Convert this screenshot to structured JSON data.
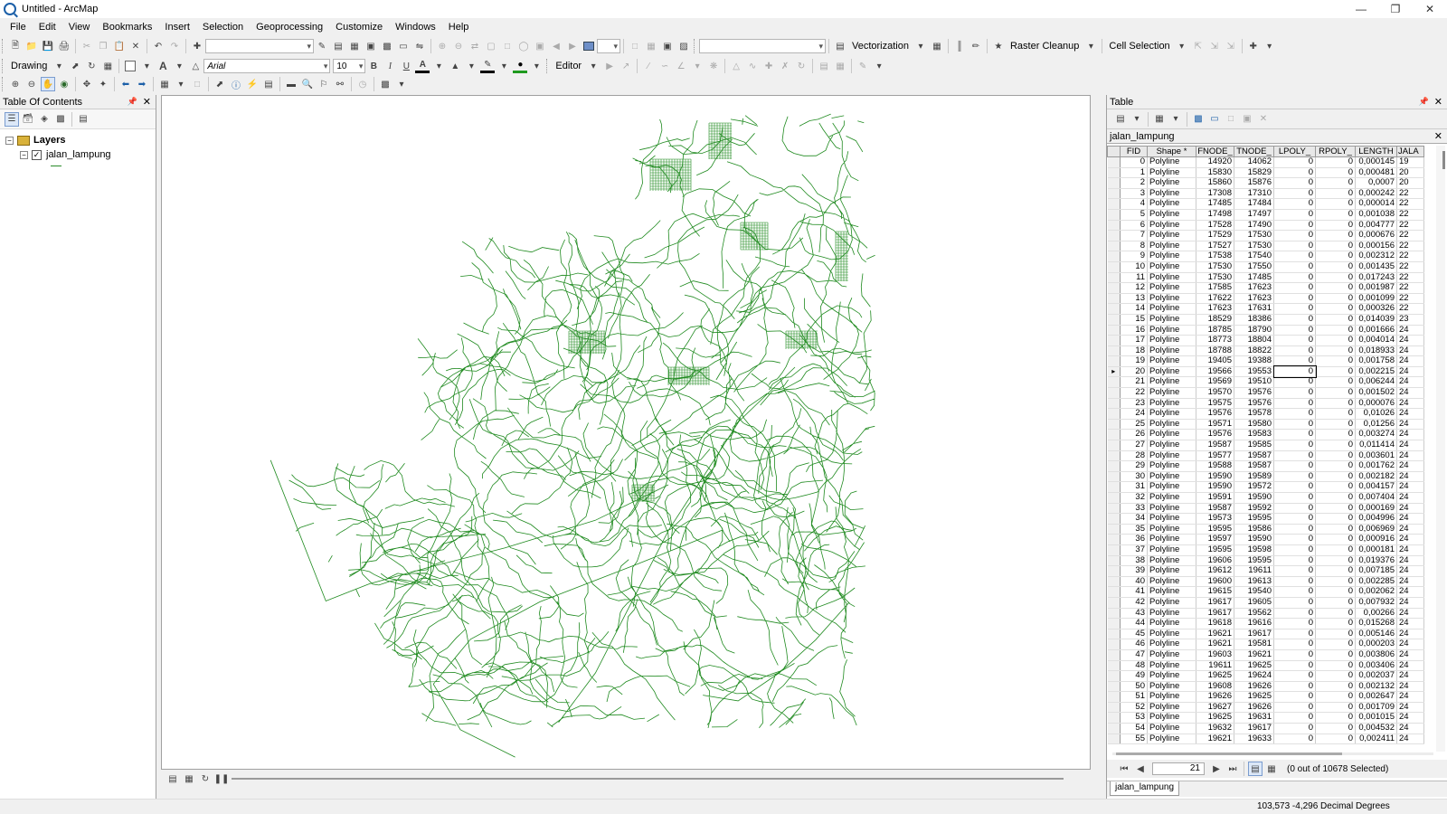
{
  "window": {
    "title": "Untitled - ArcMap",
    "controls": [
      "—",
      "❐",
      "✕"
    ]
  },
  "menu": [
    "File",
    "Edit",
    "View",
    "Bookmarks",
    "Insert",
    "Selection",
    "Geoprocessing",
    "Customize",
    "Windows",
    "Help"
  ],
  "toolbar2": {
    "vectorization_label": "Vectorization",
    "raster_cleanup_label": "Raster Cleanup",
    "cell_selection_label": "Cell Selection"
  },
  "toolbar3": {
    "drawing_label": "Drawing",
    "font_name": "Arial",
    "font_size": "10",
    "editor_label": "Editor",
    "bold": "B",
    "italic": "I",
    "underline": "U"
  },
  "toc": {
    "title": "Table Of Contents",
    "root_label": "Layers",
    "layer_name": "jalan_lampung",
    "layer_checked": true
  },
  "table": {
    "window_title": "Table",
    "table_name": "jalan_lampung",
    "columns": [
      "FID",
      "Shape *",
      "FNODE_",
      "TNODE_",
      "LPOLY_",
      "RPOLY_",
      "LENGTH",
      "JALA"
    ],
    "rows": [
      [
        "0",
        "Polyline",
        "14920",
        "14062",
        "0",
        "0",
        "0,000145",
        "19"
      ],
      [
        "1",
        "Polyline",
        "15830",
        "15829",
        "0",
        "0",
        "0,000481",
        "20"
      ],
      [
        "2",
        "Polyline",
        "15860",
        "15876",
        "0",
        "0",
        "0,0007",
        "20"
      ],
      [
        "3",
        "Polyline",
        "17308",
        "17310",
        "0",
        "0",
        "0,000242",
        "22"
      ],
      [
        "4",
        "Polyline",
        "17485",
        "17484",
        "0",
        "0",
        "0,000014",
        "22"
      ],
      [
        "5",
        "Polyline",
        "17498",
        "17497",
        "0",
        "0",
        "0,001038",
        "22"
      ],
      [
        "6",
        "Polyline",
        "17528",
        "17490",
        "0",
        "0",
        "0,004777",
        "22"
      ],
      [
        "7",
        "Polyline",
        "17529",
        "17530",
        "0",
        "0",
        "0,000676",
        "22"
      ],
      [
        "8",
        "Polyline",
        "17527",
        "17530",
        "0",
        "0",
        "0,000156",
        "22"
      ],
      [
        "9",
        "Polyline",
        "17538",
        "17540",
        "0",
        "0",
        "0,002312",
        "22"
      ],
      [
        "10",
        "Polyline",
        "17530",
        "17550",
        "0",
        "0",
        "0,001435",
        "22"
      ],
      [
        "11",
        "Polyline",
        "17530",
        "17485",
        "0",
        "0",
        "0,017243",
        "22"
      ],
      [
        "12",
        "Polyline",
        "17585",
        "17623",
        "0",
        "0",
        "0,001987",
        "22"
      ],
      [
        "13",
        "Polyline",
        "17622",
        "17623",
        "0",
        "0",
        "0,001099",
        "22"
      ],
      [
        "14",
        "Polyline",
        "17623",
        "17631",
        "0",
        "0",
        "0,000326",
        "22"
      ],
      [
        "15",
        "Polyline",
        "18529",
        "18386",
        "0",
        "0",
        "0,014039",
        "23"
      ],
      [
        "16",
        "Polyline",
        "18785",
        "18790",
        "0",
        "0",
        "0,001666",
        "24"
      ],
      [
        "17",
        "Polyline",
        "18773",
        "18804",
        "0",
        "0",
        "0,004014",
        "24"
      ],
      [
        "18",
        "Polyline",
        "18788",
        "18822",
        "0",
        "0",
        "0,018933",
        "24"
      ],
      [
        "19",
        "Polyline",
        "19405",
        "19388",
        "0",
        "0",
        "0,001758",
        "24"
      ],
      [
        "20",
        "Polyline",
        "19566",
        "19553",
        "0",
        "0",
        "0,002215",
        "24"
      ],
      [
        "21",
        "Polyline",
        "19569",
        "19510",
        "0",
        "0",
        "0,006244",
        "24"
      ],
      [
        "22",
        "Polyline",
        "19570",
        "19576",
        "0",
        "0",
        "0,001502",
        "24"
      ],
      [
        "23",
        "Polyline",
        "19575",
        "19576",
        "0",
        "0",
        "0,000076",
        "24"
      ],
      [
        "24",
        "Polyline",
        "19576",
        "19578",
        "0",
        "0",
        "0,01026",
        "24"
      ],
      [
        "25",
        "Polyline",
        "19571",
        "19580",
        "0",
        "0",
        "0,01256",
        "24"
      ],
      [
        "26",
        "Polyline",
        "19576",
        "19583",
        "0",
        "0",
        "0,003274",
        "24"
      ],
      [
        "27",
        "Polyline",
        "19587",
        "19585",
        "0",
        "0",
        "0,011414",
        "24"
      ],
      [
        "28",
        "Polyline",
        "19577",
        "19587",
        "0",
        "0",
        "0,003601",
        "24"
      ],
      [
        "29",
        "Polyline",
        "19588",
        "19587",
        "0",
        "0",
        "0,001762",
        "24"
      ],
      [
        "30",
        "Polyline",
        "19590",
        "19589",
        "0",
        "0",
        "0,002182",
        "24"
      ],
      [
        "31",
        "Polyline",
        "19590",
        "19572",
        "0",
        "0",
        "0,004157",
        "24"
      ],
      [
        "32",
        "Polyline",
        "19591",
        "19590",
        "0",
        "0",
        "0,007404",
        "24"
      ],
      [
        "33",
        "Polyline",
        "19587",
        "19592",
        "0",
        "0",
        "0,000169",
        "24"
      ],
      [
        "34",
        "Polyline",
        "19573",
        "19595",
        "0",
        "0",
        "0,004996",
        "24"
      ],
      [
        "35",
        "Polyline",
        "19595",
        "19586",
        "0",
        "0",
        "0,006969",
        "24"
      ],
      [
        "36",
        "Polyline",
        "19597",
        "19590",
        "0",
        "0",
        "0,000916",
        "24"
      ],
      [
        "37",
        "Polyline",
        "19595",
        "19598",
        "0",
        "0",
        "0,000181",
        "24"
      ],
      [
        "38",
        "Polyline",
        "19606",
        "19595",
        "0",
        "0",
        "0,019376",
        "24"
      ],
      [
        "39",
        "Polyline",
        "19612",
        "19611",
        "0",
        "0",
        "0,007185",
        "24"
      ],
      [
        "40",
        "Polyline",
        "19600",
        "19613",
        "0",
        "0",
        "0,002285",
        "24"
      ],
      [
        "41",
        "Polyline",
        "19615",
        "19540",
        "0",
        "0",
        "0,002062",
        "24"
      ],
      [
        "42",
        "Polyline",
        "19617",
        "19605",
        "0",
        "0",
        "0,007932",
        "24"
      ],
      [
        "43",
        "Polyline",
        "19617",
        "19562",
        "0",
        "0",
        "0,00266",
        "24"
      ],
      [
        "44",
        "Polyline",
        "19618",
        "19616",
        "0",
        "0",
        "0,015268",
        "24"
      ],
      [
        "45",
        "Polyline",
        "19621",
        "19617",
        "0",
        "0",
        "0,005146",
        "24"
      ],
      [
        "46",
        "Polyline",
        "19621",
        "19581",
        "0",
        "0",
        "0,000203",
        "24"
      ],
      [
        "47",
        "Polyline",
        "19603",
        "19621",
        "0",
        "0",
        "0,003806",
        "24"
      ],
      [
        "48",
        "Polyline",
        "19611",
        "19625",
        "0",
        "0",
        "0,003406",
        "24"
      ],
      [
        "49",
        "Polyline",
        "19625",
        "19624",
        "0",
        "0",
        "0,002037",
        "24"
      ],
      [
        "50",
        "Polyline",
        "19608",
        "19626",
        "0",
        "0",
        "0,002132",
        "24"
      ],
      [
        "51",
        "Polyline",
        "19626",
        "19625",
        "0",
        "0",
        "0,002647",
        "24"
      ],
      [
        "52",
        "Polyline",
        "19627",
        "19626",
        "0",
        "0",
        "0,001709",
        "24"
      ],
      [
        "53",
        "Polyline",
        "19625",
        "19631",
        "0",
        "0",
        "0,001015",
        "24"
      ],
      [
        "54",
        "Polyline",
        "19632",
        "19617",
        "0",
        "0",
        "0,004532",
        "24"
      ],
      [
        "55",
        "Polyline",
        "19621",
        "19633",
        "0",
        "0",
        "0,002411",
        "24"
      ]
    ],
    "current_row": 20,
    "record_number": "21",
    "selection_status": "(0 out of 10678 Selected)",
    "tab_label": "jalan_lampung"
  },
  "status": {
    "coordinates": "103,573  -4,296 Decimal Degrees"
  },
  "colors": {
    "road": "#1f8a1f",
    "accent": "#1b5fa8"
  }
}
